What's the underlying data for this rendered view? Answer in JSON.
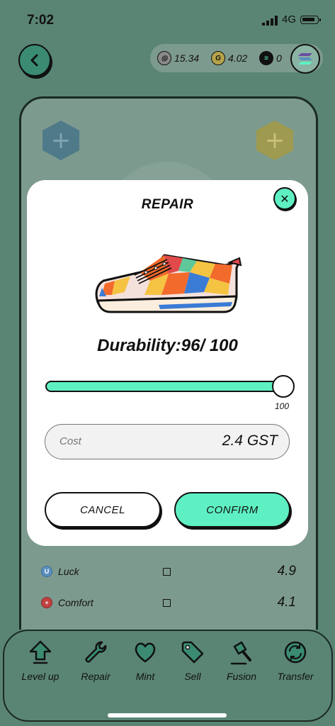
{
  "status": {
    "time": "7:02",
    "network": "4G"
  },
  "balances": [
    {
      "icon": "gmt-coin-icon",
      "value": "15.34"
    },
    {
      "icon": "gst-coin-icon",
      "value": "4.02"
    },
    {
      "icon": "sol-coin-icon",
      "value": "0"
    }
  ],
  "attributes": [
    {
      "name": "Luck",
      "icon": "luck-icon",
      "value": "4.9",
      "color": "#5a8fbf"
    },
    {
      "name": "Comfort",
      "icon": "comfort-icon",
      "value": "4.1",
      "color": "#c04040"
    }
  ],
  "modal": {
    "title": "REPAIR",
    "durability_label": "Durability:96/ 100",
    "slider": {
      "value": 100,
      "max": 100,
      "max_label": "100"
    },
    "cost_label": "Cost",
    "cost_value": "2.4 GST",
    "cancel_label": "CANCEL",
    "confirm_label": "CONFIRM"
  },
  "tabs": [
    {
      "label": "Level up",
      "icon": "level-up-icon"
    },
    {
      "label": "Repair",
      "icon": "wrench-icon"
    },
    {
      "label": "Mint",
      "icon": "heart-icon"
    },
    {
      "label": "Sell",
      "icon": "tag-icon"
    },
    {
      "label": "Fusion",
      "icon": "hammer-icon"
    },
    {
      "label": "Transfer",
      "icon": "transfer-icon"
    }
  ],
  "colors": {
    "accent": "#5ef0c3",
    "overlay_bg": "#5a8574",
    "card_bg": "#7d9a8e"
  }
}
